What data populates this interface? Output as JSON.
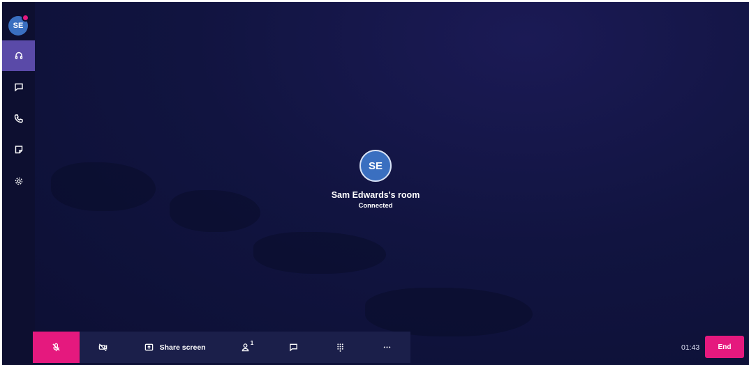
{
  "user": {
    "initials": "SE"
  },
  "sidebar": {
    "items": [
      {
        "icon": "headset-icon",
        "active": true
      },
      {
        "icon": "chat-icon",
        "active": false
      },
      {
        "icon": "phone-icon",
        "active": false
      },
      {
        "icon": "note-icon",
        "active": false
      },
      {
        "icon": "settings-icon",
        "active": false
      }
    ]
  },
  "call": {
    "initials": "SE",
    "room_name": "Sam Edwards's room",
    "status": "Connected",
    "timer": "01:43",
    "end_label": "End"
  },
  "toolbar": {
    "share_label": "Share screen",
    "participants_count": "1",
    "accent_color": "#e5197e"
  }
}
